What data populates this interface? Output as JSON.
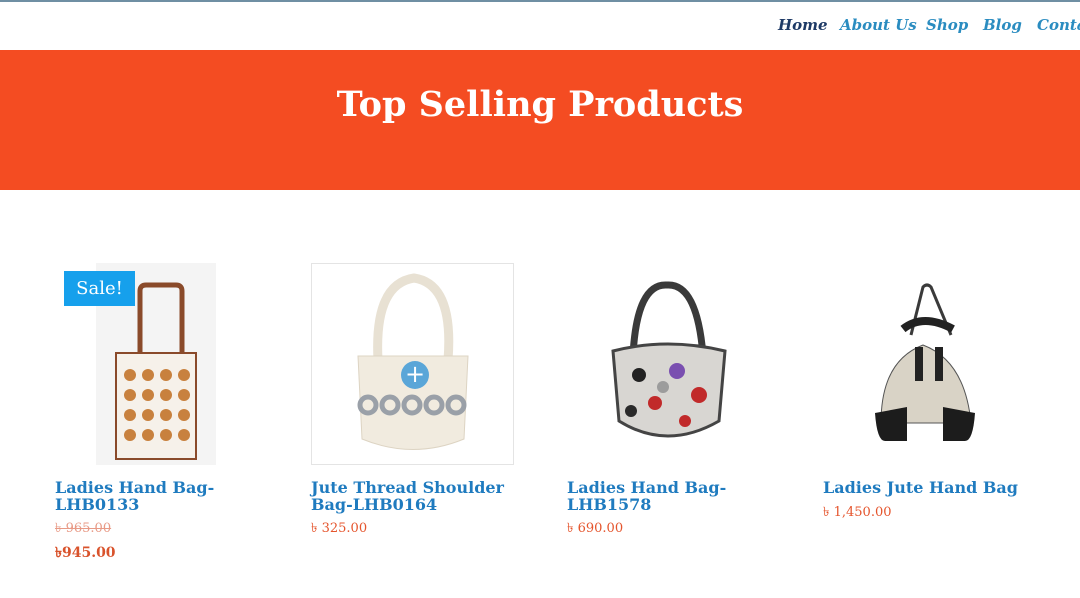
{
  "nav": {
    "items": [
      "Home",
      "About Us",
      "Shop",
      "Blog",
      "Contac"
    ],
    "active": "Home"
  },
  "hero": {
    "title": "Top Selling Products",
    "color": "#f44c22"
  },
  "products": [
    {
      "title_line1": "Ladies Hand Bag-",
      "title_line2": "LHB0133",
      "old_price": "৳ 965.00",
      "price": "৳945.00",
      "badge": "Sale!"
    },
    {
      "title_line1": "Jute Thread Shoulder",
      "title_line2": "Bag-LHB0164",
      "price": "৳ 325.00",
      "icon": "zoom-plus-icon"
    },
    {
      "title_line1": "Ladies Hand Bag-",
      "title_line2": "LHB1578",
      "price": "৳ 690.00"
    },
    {
      "title_line1": "Ladies Jute Hand Bag",
      "title_line2": "",
      "price": "৳ 1,450.00"
    }
  ],
  "colors": {
    "link": "#2a8cc0",
    "active_link": "#1e3a66",
    "price": "#e5552d",
    "badge": "#16a0ec"
  }
}
